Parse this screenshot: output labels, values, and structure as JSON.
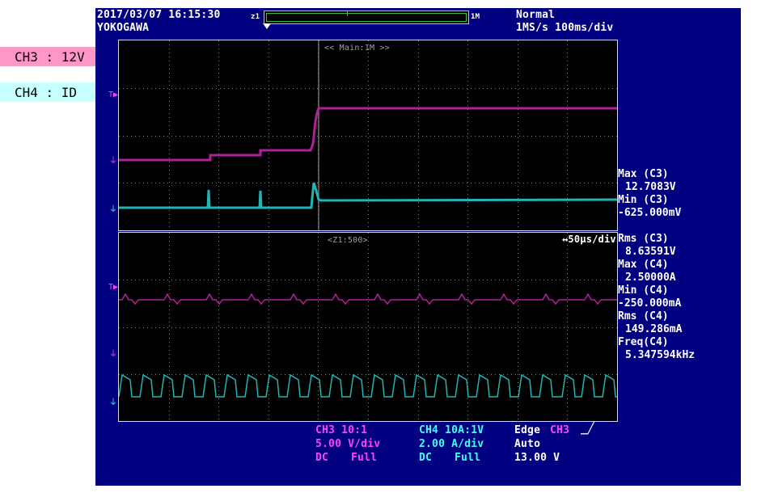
{
  "labels": {
    "ch3": "CH3 : 12V",
    "ch4": "CH4 : ID"
  },
  "header": {
    "datetime": "2017/03/07 16:15:30",
    "brand": "YOKOGAWA",
    "overview_left": "z1",
    "overview_right": "1M",
    "mode": "Normal",
    "rate": "1MS/s 100ms/div"
  },
  "main_screen": {
    "label": "<< Main:1M >>"
  },
  "zoom_screen": {
    "label": "<Z1:500>",
    "timebase": "↔50µs/div"
  },
  "measurements": [
    {
      "label": "Max (C3)",
      "value": "12.7083V"
    },
    {
      "label": "Min (C3)",
      "value": "-625.000mV"
    },
    {
      "label": "Rms (C3)",
      "value": "8.63591V"
    },
    {
      "label": "Max (C4)",
      "value": "2.50000A"
    },
    {
      "label": "Min (C4)",
      "value": "-250.000mA"
    },
    {
      "label": "Rms (C4)",
      "value": "149.286mA"
    },
    {
      "label": "Freq(C4)",
      "value": "5.347594kHz"
    }
  ],
  "bottom": {
    "ch3": {
      "probe": "CH3 10:1",
      "scale": "5.00 V/div",
      "coupling": "DC",
      "bw": "Full"
    },
    "ch4": {
      "probe": "CH4 10A:1V",
      "scale": "2.00 A/div",
      "coupling": "DC",
      "bw": "Full"
    },
    "trigger": {
      "type": "Edge",
      "source": "CH3",
      "mode": "Auto",
      "level": "13.00 V"
    }
  },
  "colors": {
    "ch3": "#b0209a",
    "ch4": "#20b4b4",
    "ch3_text": "#ff40ff",
    "ch4_text": "#40ffff",
    "background": "#000080",
    "grid": "#7a7a7a"
  }
}
